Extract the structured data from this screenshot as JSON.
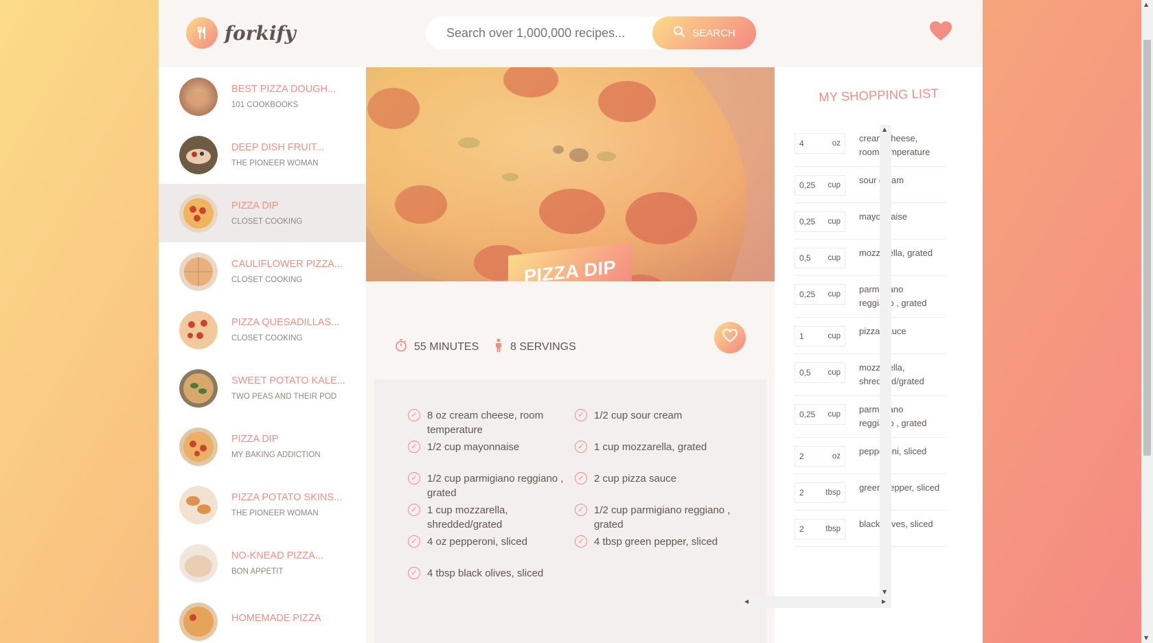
{
  "app": {
    "name": "forkify"
  },
  "search": {
    "placeholder": "Search over 1,000,000 recipes...",
    "button_label": "SEARCH"
  },
  "results": [
    {
      "title": "BEST PIZZA DOUGH...",
      "publisher": "101 COOKBOOKS",
      "active": false
    },
    {
      "title": "DEEP DISH FRUIT...",
      "publisher": "THE PIONEER WOMAN",
      "active": false
    },
    {
      "title": "PIZZA DIP",
      "publisher": "CLOSET COOKING",
      "active": true
    },
    {
      "title": "CAULIFLOWER PIZZA...",
      "publisher": "CLOSET COOKING",
      "active": false
    },
    {
      "title": "PIZZA QUESADILLAS...",
      "publisher": "CLOSET COOKING",
      "active": false
    },
    {
      "title": "SWEET POTATO KALE...",
      "publisher": "TWO PEAS AND THEIR POD",
      "active": false
    },
    {
      "title": "PIZZA DIP",
      "publisher": "MY BAKING ADDICTION",
      "active": false
    },
    {
      "title": "PIZZA POTATO SKINS...",
      "publisher": "THE PIONEER WOMAN",
      "active": false
    },
    {
      "title": "NO-KNEAD PIZZA...",
      "publisher": "BON APPETIT",
      "active": false
    },
    {
      "title": "HOMEMADE PIZZA",
      "publisher": "",
      "active": false
    }
  ],
  "recipe": {
    "title": "PIZZA DIP",
    "time": "55",
    "time_unit": "MINUTES",
    "servings": "8",
    "servings_unit": "SERVINGS",
    "ingredients": [
      "8 oz cream cheese, room temperature",
      "1/2 cup sour cream",
      "1/2 cup mayonnaise",
      "1 cup mozzarella, grated",
      "1/2 cup parmigiano reggiano , grated",
      "2 cup pizza sauce",
      "1 cup mozzarella, shredded/grated",
      "1/2 cup parmigiano reggiano , grated",
      "4 oz pepperoni, sliced",
      "4 tbsp green pepper, sliced",
      "4 tbsp black olives, sliced"
    ]
  },
  "shopping": {
    "title": "MY SHOPPING LIST",
    "items": [
      {
        "count": "4",
        "unit": "oz",
        "desc": "cream cheese, room temperature"
      },
      {
        "count": "0,25",
        "unit": "cup",
        "desc": "sour cream"
      },
      {
        "count": "0,25",
        "unit": "cup",
        "desc": "mayonnaise"
      },
      {
        "count": "0,5",
        "unit": "cup",
        "desc": "mozzarella, grated"
      },
      {
        "count": "0,25",
        "unit": "cup",
        "desc": "parmigiano reggiano , grated"
      },
      {
        "count": "1",
        "unit": "cup",
        "desc": "pizza sauce"
      },
      {
        "count": "0,5",
        "unit": "cup",
        "desc": "mozzarella, shredded/grated"
      },
      {
        "count": "0,25",
        "unit": "cup",
        "desc": "parmigiano reggiano , grated"
      },
      {
        "count": "2",
        "unit": "oz",
        "desc": "pepperoni, sliced"
      },
      {
        "count": "2",
        "unit": "tbsp",
        "desc": "green pepper, sliced"
      },
      {
        "count": "2",
        "unit": "tbsp",
        "desc": "black olives, sliced"
      }
    ]
  },
  "colors": {
    "accent": "#f38e82",
    "accent_light": "#fbdb89",
    "text": "#615551",
    "muted": "#918581"
  },
  "icons": {
    "logo": "fork-knife-icon",
    "search": "search-icon",
    "bookmarks": "heart-icon",
    "time": "stopwatch-icon",
    "servings": "man-icon",
    "ingredient": "check-circle-icon"
  }
}
